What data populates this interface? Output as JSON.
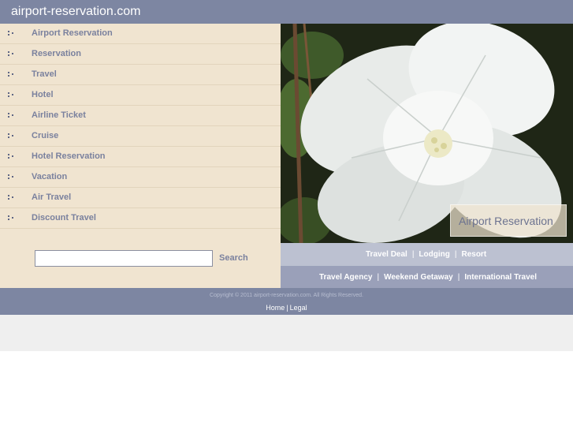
{
  "header": {
    "site_title": "airport-reservation.com"
  },
  "sidebar": {
    "items": [
      {
        "label": "Airport Reservation"
      },
      {
        "label": "Reservation"
      },
      {
        "label": "Travel"
      },
      {
        "label": "Hotel"
      },
      {
        "label": "Airline Ticket"
      },
      {
        "label": "Cruise"
      },
      {
        "label": "Hotel Reservation"
      },
      {
        "label": "Vacation"
      },
      {
        "label": "Air Travel"
      },
      {
        "label": "Discount Travel"
      }
    ],
    "search": {
      "value": "",
      "placeholder": "",
      "button_label": "Search"
    }
  },
  "hero": {
    "caption": "Airport Reservation",
    "image": "white-hibiscus-flower"
  },
  "links_row_1": {
    "items": [
      "Travel Deal",
      "Lodging",
      "Resort"
    ],
    "separator": "|"
  },
  "links_row_2": {
    "items": [
      "Travel Agency",
      "Weekend Getaway",
      "International Travel"
    ],
    "separator": "|"
  },
  "footer": {
    "copyright": "Copyright © 2011 airport-reservation.com. All Rights Reserved.",
    "links": [
      "Home",
      "Legal"
    ],
    "separator": "|"
  },
  "colors": {
    "header_bg": "#7d86a2",
    "sidebar_bg": "#f0e4d0",
    "nav_text": "#7a819e",
    "links_bar_light": "#bcc1d1",
    "links_bar_dark": "#9aa0b9"
  }
}
